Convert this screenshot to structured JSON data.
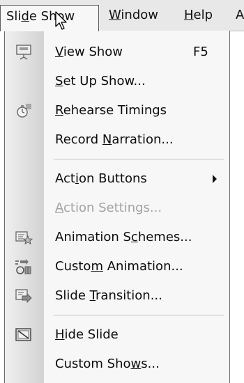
{
  "menubar": {
    "items": [
      {
        "name": "menubar-slide-show",
        "pre": "Sli",
        "mn": "d",
        "post": "e Show",
        "open": true
      },
      {
        "name": "menubar-window",
        "pre": "",
        "mn": "W",
        "post": "indow",
        "open": false
      },
      {
        "name": "menubar-help",
        "pre": "",
        "mn": "H",
        "post": "elp",
        "open": false
      },
      {
        "name": "menubar-truncated",
        "pre": "A",
        "mn": "",
        "post": "",
        "open": false
      }
    ]
  },
  "menu": {
    "items": [
      {
        "pre": "",
        "mn": "V",
        "post": "iew Show",
        "shortcut": "F5",
        "icon": "projector-screen-icon",
        "enabled": true,
        "submenu": false
      },
      {
        "pre": "",
        "mn": "S",
        "post": "et Up Show...",
        "shortcut": "",
        "icon": "",
        "enabled": true,
        "submenu": false
      },
      {
        "pre": "",
        "mn": "R",
        "post": "ehearse Timings",
        "shortcut": "",
        "icon": "stopwatch-icon",
        "enabled": true,
        "submenu": false
      },
      {
        "pre": "Record ",
        "mn": "N",
        "post": "arration...",
        "shortcut": "",
        "icon": "",
        "enabled": true,
        "submenu": false
      },
      {
        "pre": "Act",
        "mn": "i",
        "post": "on Buttons",
        "shortcut": "",
        "icon": "",
        "enabled": true,
        "submenu": true
      },
      {
        "pre": "",
        "mn": "A",
        "post": "ction Settings...",
        "shortcut": "",
        "icon": "",
        "enabled": false,
        "submenu": false
      },
      {
        "pre": "Animation S",
        "mn": "c",
        "post": "hemes...",
        "shortcut": "",
        "icon": "animation-schemes-icon",
        "enabled": true,
        "submenu": false
      },
      {
        "pre": "Custo",
        "mn": "m",
        "post": " Animation...",
        "shortcut": "",
        "icon": "custom-animation-icon",
        "enabled": true,
        "submenu": false
      },
      {
        "pre": "Slide ",
        "mn": "T",
        "post": "ransition...",
        "shortcut": "",
        "icon": "slide-transition-icon",
        "enabled": true,
        "submenu": false
      },
      {
        "pre": "",
        "mn": "H",
        "post": "ide Slide",
        "shortcut": "",
        "icon": "hide-slide-icon",
        "enabled": true,
        "submenu": false
      },
      {
        "pre": "Custom Sho",
        "mn": "w",
        "post": "s...",
        "shortcut": "",
        "icon": "",
        "enabled": true,
        "submenu": false
      }
    ]
  },
  "colors": {
    "menu_background": "#f7f7f7",
    "menubar_background": "#e8e8e8",
    "disabled_text": "#a2a2a2",
    "text": "#0c0c0c"
  }
}
